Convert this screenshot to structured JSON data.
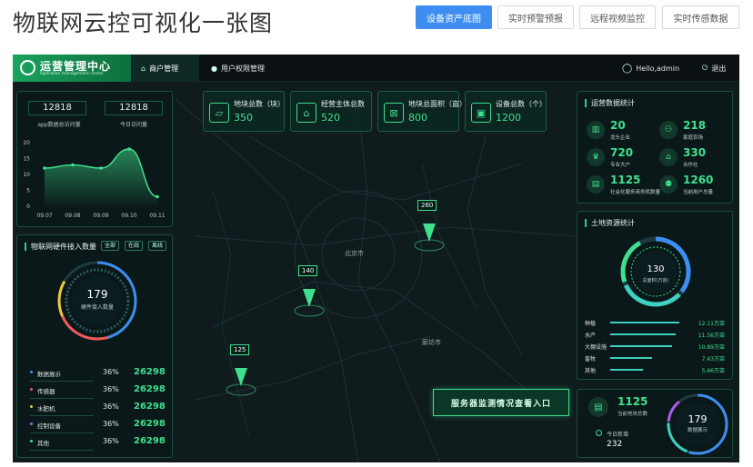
{
  "page_title": "物联网云控可视化一张图",
  "top_buttons": [
    {
      "label": "设备资产底图",
      "active": true
    },
    {
      "label": "实时预警预报",
      "active": false
    },
    {
      "label": "远程视频监控",
      "active": false
    },
    {
      "label": "实时传感数据",
      "active": false
    }
  ],
  "nav": {
    "logo_title": "运营管理中心",
    "logo_subtitle": "Operation management center",
    "tabs": [
      "商户管理",
      "用户权限管理"
    ],
    "greeting": "Hello,admin",
    "logout": "退出"
  },
  "visits": {
    "app_count": "12818",
    "app_label": "app数据总访问量",
    "today_count": "12818",
    "today_label": "今日访问量"
  },
  "visits_chart": {
    "type": "area",
    "x": [
      "09.07",
      "09.08",
      "09.09",
      "09.10",
      "09.11"
    ],
    "y": [
      12,
      13,
      12,
      18,
      3
    ],
    "yticks": [
      "20",
      "15",
      "10",
      "5",
      "0"
    ],
    "ylim": [
      0,
      20
    ]
  },
  "stat_boxes": [
    {
      "icon": "plot-icon",
      "label": "地块总数（块）",
      "value": "350"
    },
    {
      "icon": "entity-icon",
      "label": "经营主体总数",
      "value": "520"
    },
    {
      "icon": "area-icon",
      "label": "地块总面积（亩）",
      "value": "800"
    },
    {
      "icon": "device-icon",
      "label": "设备总数（个）",
      "value": "1200"
    }
  ],
  "ops": {
    "title": "运营数据统计",
    "items": [
      {
        "value": "20",
        "label": "龙头企业"
      },
      {
        "value": "218",
        "label": "家庭农场"
      },
      {
        "value": "720",
        "label": "专业大户"
      },
      {
        "value": "330",
        "label": "合作社"
      },
      {
        "value": "1125",
        "label": "社会化服务商务机数量"
      },
      {
        "value": "1260",
        "label": "当前用户总量"
      }
    ]
  },
  "land": {
    "title": "土地资源统计",
    "center_value": "130",
    "center_label": "总面积(万亩)",
    "rows": [
      {
        "name": "种植",
        "value": "12.11万亩",
        "fraction": 1.0
      },
      {
        "name": "水产",
        "value": "11.56万亩",
        "fraction": 0.95
      },
      {
        "name": "大棚设施",
        "value": "10.89万亩",
        "fraction": 0.9
      },
      {
        "name": "畜牧",
        "value": "7.43万亩",
        "fraction": 0.61
      },
      {
        "name": "其他",
        "value": "5.66万亩",
        "fraction": 0.47
      }
    ]
  },
  "hardware": {
    "title": "物联网硬件接入数量",
    "filters": [
      "全部",
      "在线",
      "离线"
    ],
    "center_value": "179",
    "center_label": "硬件接入数量",
    "rows": [
      {
        "name": "数据展示",
        "percent": "36%",
        "value": "26298",
        "color": "#3d8ef0"
      },
      {
        "name": "传感器",
        "percent": "36%",
        "value": "26298",
        "color": "#ef5a5a"
      },
      {
        "name": "水肥机",
        "percent": "36%",
        "value": "26298",
        "color": "#f0c83d"
      },
      {
        "name": "控制设备",
        "percent": "36%",
        "value": "26298",
        "color": "#b05af0"
      },
      {
        "name": "其他",
        "percent": "36%",
        "value": "26298",
        "color": "#3ee08e"
      }
    ]
  },
  "markers": [
    {
      "label": "260"
    },
    {
      "label": "140"
    },
    {
      "label": "125"
    }
  ],
  "map_labels": [
    "北京市",
    "廊坊市"
  ],
  "server_button": "服务器监测情况查看入口",
  "plots": {
    "value": "1125",
    "label": "当前地块总数",
    "new_label": "今日新增",
    "new_value": "232",
    "ring_value": "179",
    "ring_label": "数据展示"
  },
  "colors": {
    "accent": "#3ee08e",
    "brand": "#3d8ef0",
    "panel_border": "#1d4d3c"
  }
}
